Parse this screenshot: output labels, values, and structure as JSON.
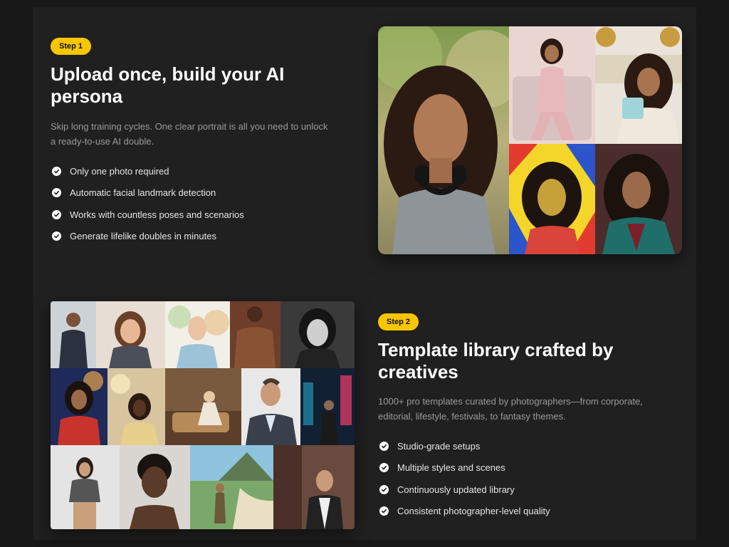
{
  "step1": {
    "badge": "Step 1",
    "title_line1": "Upload once, build your AI",
    "title_line2": "persona",
    "desc_line1": "Skip long training cycles. One clear portrait is all you need to unlock",
    "desc_line2": "a ready-to-use AI double.",
    "features": [
      "Only one photo required",
      "Automatic facial landmark detection",
      "Works with countless poses and scenarios",
      "Generate lifelike doubles in minutes"
    ]
  },
  "step2": {
    "badge": "Step 2",
    "title_line1": "Template library crafted by",
    "title_line2": "creatives",
    "desc_line1": "1000+ pro templates curated by photographers—from corporate,",
    "desc_line2": "editorial, lifestyle, festivals, to fantasy themes.",
    "features": [
      "Studio-grade setups",
      "Multiple styles and scenes",
      "Continuously updated library",
      "Consistent photographer-level quality"
    ]
  },
  "colors": {
    "accent": "#f7c600",
    "page_background": "#181818",
    "panel_background": "#202020",
    "heading": "#ffffff",
    "muted_text": "#9a9a9a"
  },
  "icons": {
    "feature_bullet": "check-circle-icon"
  }
}
